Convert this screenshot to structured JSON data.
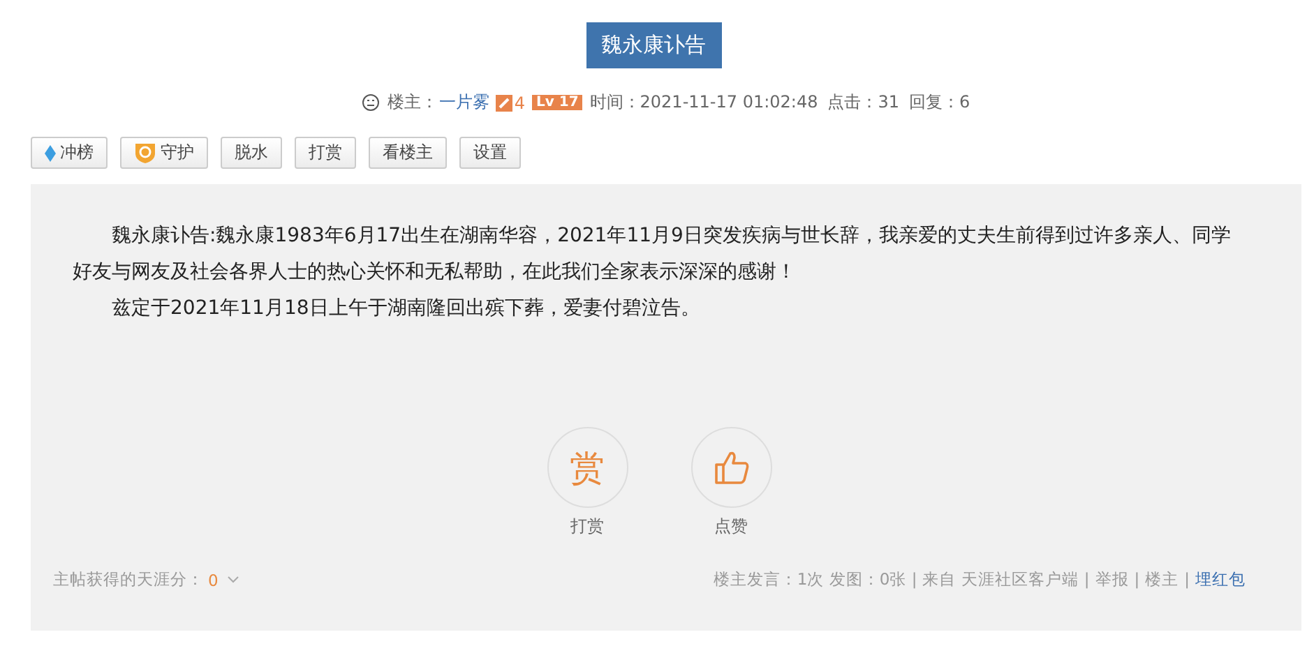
{
  "title": "魏永康讣告",
  "meta": {
    "author_label": "楼主：",
    "author": "一片雾",
    "edit_count": "4",
    "level": "Lv 17",
    "time": "时间：2021-11-17 01:02:48",
    "clicks": "点击：31",
    "replies": "回复：6"
  },
  "toolbar": [
    {
      "label": "冲榜",
      "kind": "rank"
    },
    {
      "label": "守护",
      "kind": "guard"
    },
    {
      "label": "脱水",
      "kind": "plain"
    },
    {
      "label": "打赏",
      "kind": "plain"
    },
    {
      "label": "看楼主",
      "kind": "plain"
    },
    {
      "label": "设置",
      "kind": "plain"
    }
  ],
  "post": {
    "paragraphs": [
      "魏永康讣告:魏永康1983年6月17出生在湖南华容，2021年11月9日突发疾病与世长辞，我亲爱的丈夫生前得到过许多亲人、同学好友与网友及社会各界人士的热心关怀和无私帮助，在此我们全家表示深深的感谢！",
      "兹定于2021年11月18日上午于湖南隆回出殡下葬，爱妻付碧泣告。"
    ],
    "actions": [
      {
        "kind": "reward",
        "glyph": "赏",
        "label": "打赏"
      },
      {
        "kind": "like",
        "label": "点赞"
      }
    ],
    "score_label": "主帖获得的天涯分：",
    "score": "0",
    "footer": [
      {
        "text": "楼主发言：1次 发图：0张 |",
        "kind": "text"
      },
      {
        "text": "来自 天涯社区客户端",
        "kind": "text"
      },
      {
        "text": "|",
        "kind": "sep"
      },
      {
        "text": "举报",
        "kind": "link"
      },
      {
        "text": "|",
        "kind": "sep"
      },
      {
        "text": "楼主",
        "kind": "link"
      },
      {
        "text": "|",
        "kind": "sep"
      },
      {
        "text": "埋红包",
        "kind": "accent"
      }
    ]
  }
}
